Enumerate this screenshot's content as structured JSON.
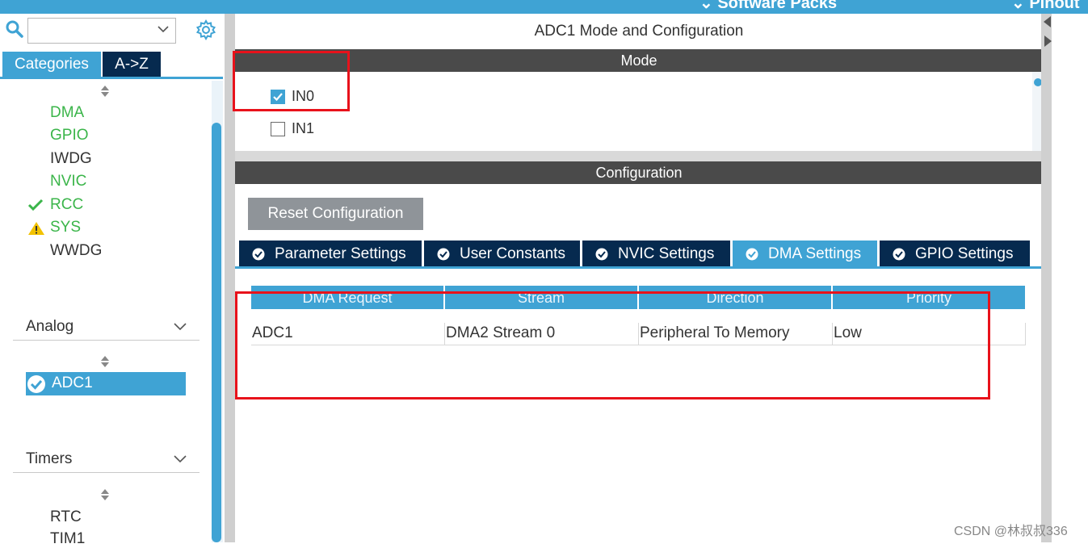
{
  "topbar": {
    "menu_software_packs": "Software Packs",
    "menu_pinout": "Pinout"
  },
  "sidebar": {
    "search": {
      "value": "",
      "placeholder": ""
    },
    "tabs": [
      "Categories",
      "A->Z"
    ],
    "system_core_items": [
      {
        "label": "DMA",
        "color": "#3bb54a",
        "status": "none"
      },
      {
        "label": "GPIO",
        "color": "#3bb54a",
        "status": "none"
      },
      {
        "label": "IWDG",
        "color": "#333333",
        "status": "none"
      },
      {
        "label": "NVIC",
        "color": "#3bb54a",
        "status": "none"
      },
      {
        "label": "RCC",
        "color": "#3bb54a",
        "status": "check-icon"
      },
      {
        "label": "SYS",
        "color": "#3bb54a",
        "status": "warning-icon"
      },
      {
        "label": "WWDG",
        "color": "#333333",
        "status": "none"
      }
    ],
    "groups": {
      "analog": {
        "label": "Analog",
        "items": [
          {
            "label": "ADC1",
            "selected": true
          }
        ]
      },
      "timers": {
        "label": "Timers",
        "items": [
          {
            "label": "RTC"
          },
          {
            "label": "TIM1"
          }
        ]
      }
    }
  },
  "main": {
    "title": "ADC1 Mode and Configuration",
    "mode": {
      "header": "Mode",
      "checkboxes": [
        {
          "label": "IN0",
          "checked": true
        },
        {
          "label": "IN1",
          "checked": false
        }
      ]
    },
    "configuration": {
      "header": "Configuration",
      "reset_button": "Reset Configuration",
      "tabs": [
        {
          "label": "Parameter Settings",
          "active": false
        },
        {
          "label": "User Constants",
          "active": false
        },
        {
          "label": "NVIC Settings",
          "active": false
        },
        {
          "label": "DMA Settings",
          "active": true
        },
        {
          "label": "GPIO Settings",
          "active": false
        }
      ],
      "dma_table": {
        "columns": [
          "DMA Request",
          "Stream",
          "Direction",
          "Priority"
        ],
        "rows": [
          [
            "ADC1",
            "DMA2 Stream 0",
            "Peripheral To Memory",
            "Low"
          ]
        ]
      }
    }
  },
  "colors": {
    "accent": "#3fa3d4",
    "dark_tab": "#062a4f",
    "header_gray": "#4a4a4a",
    "highlight_red": "#e8121b",
    "enabled_green": "#3bb54a"
  },
  "watermark": "CSDN @林叔叔336"
}
